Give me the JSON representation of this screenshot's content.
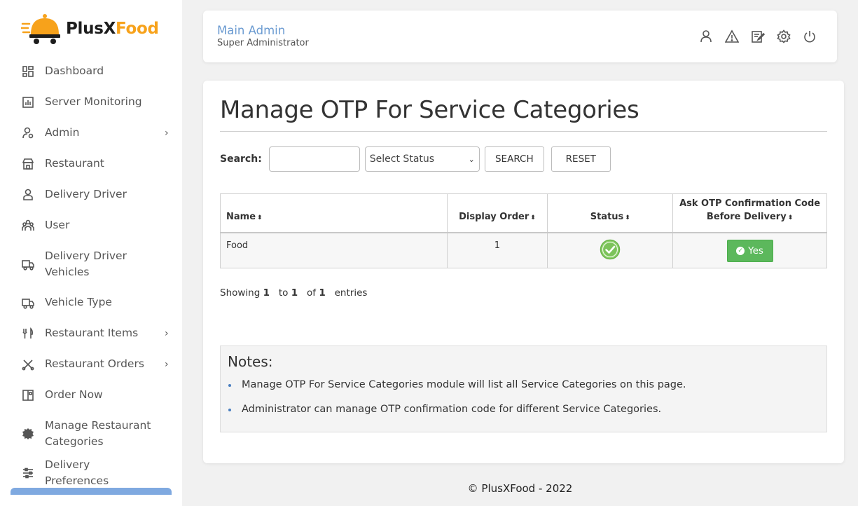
{
  "brand": {
    "name_part1": "PlusX",
    "name_part2": "Food",
    "accent": "#f7a21b"
  },
  "sidebar": {
    "items": [
      {
        "label": "Dashboard",
        "icon": "dashboard-icon"
      },
      {
        "label": "Server Monitoring",
        "icon": "chart-icon"
      },
      {
        "label": "Admin",
        "icon": "user-settings-icon",
        "has_submenu": true,
        "chevron": "›"
      },
      {
        "label": "Restaurant",
        "icon": "store-icon"
      },
      {
        "label": "Delivery Driver",
        "icon": "driver-icon"
      },
      {
        "label": "User",
        "icon": "users-icon"
      },
      {
        "label": "Delivery Driver Vehicles",
        "icon": "truck-icon"
      },
      {
        "label": "Vehicle Type",
        "icon": "truck-icon"
      },
      {
        "label": "Restaurant Items",
        "icon": "fork-knife-icon",
        "has_submenu": true,
        "chevron": "›"
      },
      {
        "label": "Restaurant Orders",
        "icon": "scissors-icon",
        "has_submenu": true,
        "chevron": "›"
      },
      {
        "label": "Order Now",
        "icon": "menu-book-icon"
      },
      {
        "label": "Manage Restaurant Categories",
        "icon": "gear-badge-icon"
      },
      {
        "label": "Delivery Preferences",
        "icon": "sliders-icon"
      }
    ]
  },
  "header": {
    "user_name": "Main Admin",
    "user_role": "Super Administrator",
    "icons": [
      "profile-icon",
      "alert-icon",
      "edit-icon",
      "settings-icon",
      "power-icon"
    ]
  },
  "page": {
    "title": "Manage OTP For Service Categories",
    "search_label": "Search:",
    "search_value": "",
    "status_select": "Select Status",
    "search_button": "SEARCH",
    "reset_button": "RESET"
  },
  "table": {
    "columns": [
      "Name",
      "Display Order",
      "Status",
      "Ask OTP Confirmation Code Before Delivery"
    ],
    "sort_glyph": "⬍",
    "rows": [
      {
        "name": "Food",
        "display_order": "1",
        "status": "active",
        "ask_otp": "Yes"
      }
    ]
  },
  "pagination": {
    "prefix": "Showing",
    "from": "1",
    "to_word": "to",
    "to": "1",
    "of_word": "of",
    "total": "1",
    "suffix": "entries"
  },
  "notes": {
    "title": "Notes:",
    "items": [
      "Manage OTP For Service Categories module will list all Service Categories on this page.",
      "Administrator can manage OTP confirmation code for different Service Categories."
    ]
  },
  "footer": {
    "text": "© PlusXFood - 2022"
  },
  "colors": {
    "link_blue": "#6b9bd1",
    "success_green": "#5cb85c"
  }
}
